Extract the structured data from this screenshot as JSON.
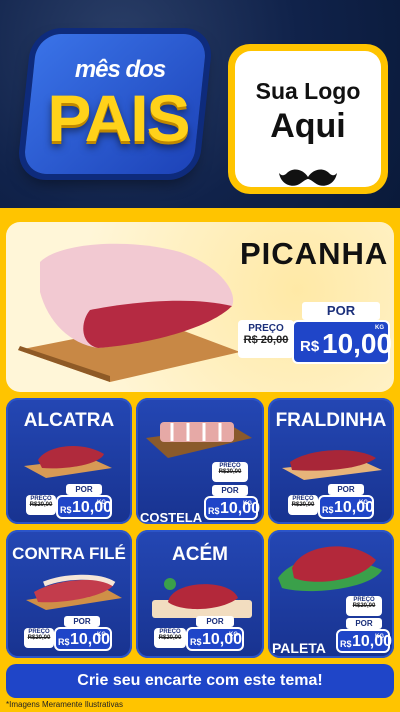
{
  "header": {
    "badge_top": "mês dos",
    "badge_main": "PAIS",
    "logo_line1": "Sua Logo",
    "logo_line2": "Aqui"
  },
  "hero": {
    "title": "PICANHA",
    "price_label": "PREÇO",
    "old_price": "R$ 20,00",
    "por": "POR",
    "currency": "R$",
    "new_price": "10,00",
    "unit": "KG"
  },
  "products": [
    {
      "name": "ALCATRA",
      "price_label": "PREÇO",
      "old_price": "R$20,00",
      "por": "POR",
      "currency": "R$",
      "new_price": "10,00",
      "unit": "KG"
    },
    {
      "name": "COSTELA",
      "price_label": "PREÇO",
      "old_price": "R$20,00",
      "por": "POR",
      "currency": "R$",
      "new_price": "10,00",
      "unit": "KG"
    },
    {
      "name": "FRALDINHA",
      "price_label": "PREÇO",
      "old_price": "R$20,00",
      "por": "POR",
      "currency": "R$",
      "new_price": "10,00",
      "unit": "KG"
    },
    {
      "name": "CONTRA FILÉ",
      "price_label": "PREÇO",
      "old_price": "R$20,00",
      "por": "POR",
      "currency": "R$",
      "new_price": "10,00",
      "unit": "KG"
    },
    {
      "name": "ACÉM",
      "price_label": "PREÇO",
      "old_price": "R$20,00",
      "por": "POR",
      "currency": "R$",
      "new_price": "10,00",
      "unit": "KG"
    },
    {
      "name": "PALETA",
      "price_label": "PREÇO",
      "old_price": "R$20,00",
      "por": "POR",
      "currency": "R$",
      "new_price": "10,00",
      "unit": "KG"
    }
  ],
  "footer": {
    "cta": "Crie seu encarte com este tema!",
    "note": "*Imagens Meramente Ilustrativas"
  },
  "colors": {
    "yellow": "#ffc400",
    "blue": "#1f45c8",
    "dark_navy": "#0d2146"
  }
}
